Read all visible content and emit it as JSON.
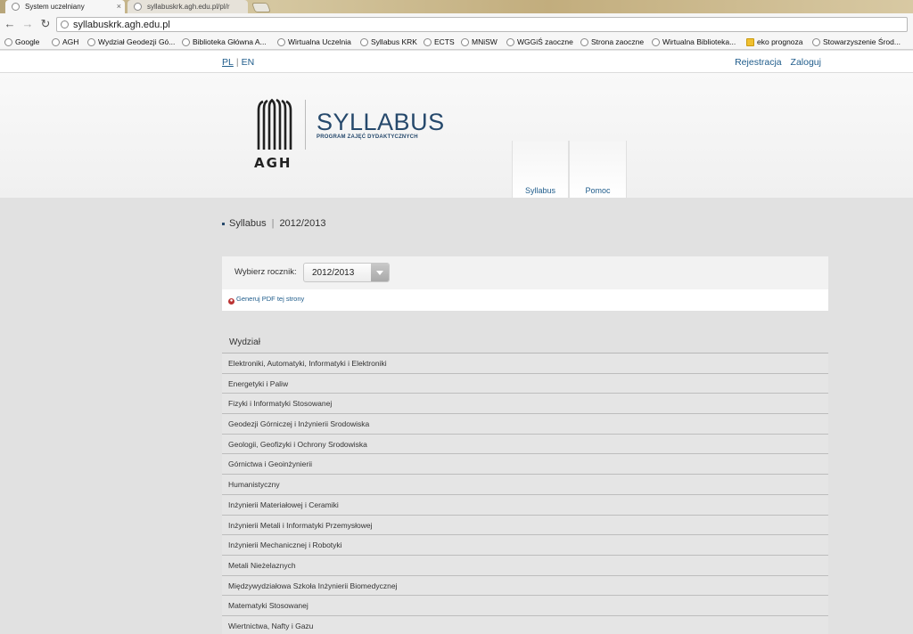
{
  "browser": {
    "tabs": [
      {
        "label": "System uczelniany",
        "active": true
      },
      {
        "label": "syllabuskrk.agh.edu.pl/pl/r",
        "active": false
      }
    ],
    "address": "syllabuskrk.agh.edu.pl",
    "nav_icons": [
      "back-icon",
      "forward-icon",
      "reload-icon"
    ],
    "bookmarks": [
      "Google",
      "AGH",
      "Wydział Geodezji Gó...",
      "Biblioteka Główna A...",
      "Wirtualna Uczelnia",
      "Syllabus KRK",
      "ECTS",
      "MNiSW",
      "WGGiŚ zaoczne",
      "Strona zaoczne",
      "Wirtualna Biblioteka...",
      "eko prognoza",
      "Stowarzyszenie Środ..."
    ]
  },
  "topbar": {
    "lang_pl": "PL",
    "lang_sep": "|",
    "lang_en": "EN",
    "register": "Rejestracja",
    "login": "Zaloguj"
  },
  "header": {
    "logo_text": "AGH",
    "brand": "SYLLABUS",
    "tagline": "PROGRAM ZAJĘĆ DYDAKTYCZNYCH",
    "nav": [
      "Syllabus",
      "Pomoc"
    ]
  },
  "breadcrumb": {
    "section": "Syllabus",
    "separator": "|",
    "year": "2012/2013"
  },
  "filter": {
    "label": "Wybierz rocznik:",
    "selected": "2012/2013",
    "pdf_link": "Generuj PDF tej strony"
  },
  "departments": {
    "heading": "Wydział",
    "items": [
      "Elektroniki, Automatyki, Informatyki i Elektroniki",
      "Energetyki i Paliw",
      "Fizyki i Informatyki Stosowanej",
      "Geodezji Górniczej i Inżynierii Srodowiska",
      "Geologii, Geofizyki i Ochrony Srodowiska",
      "Górnictwa i Geoinżynierii",
      "Humanistyczny",
      "Inżynierii Materiałowej i Ceramiki",
      "Inżynierii Metali i Informatyki Przemysłowej",
      "Inżynierii Mechanicznej i Robotyki",
      "Metali Nieżelaznych",
      "Międzywydziałowa Szkoła Inżynierii Biomedycznej",
      "Matematyki Stosowanej",
      "Wiertnictwa, Nafty i Gazu"
    ]
  }
}
